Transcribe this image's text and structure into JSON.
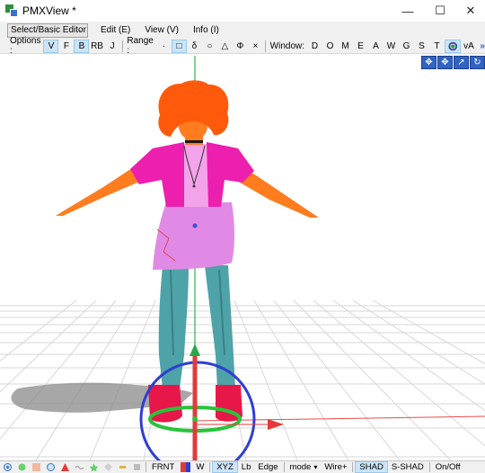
{
  "window": {
    "title": "PMXView *",
    "minimize": "—",
    "maximize": "☐",
    "close": "✕"
  },
  "menubar": {
    "mode_select": "Select/Basic Editor",
    "edit": "Edit (E)",
    "view": "View (V)",
    "info": "Info (I)"
  },
  "toolbar": {
    "options_label": "Options :",
    "options": [
      "V",
      "F",
      "B",
      "RB",
      "J"
    ],
    "range_label": "Range :",
    "range": [
      "·",
      "□",
      "δ",
      "○",
      "△",
      "Φ",
      "×"
    ],
    "window_label": "Window:",
    "window_items": [
      "D",
      "O",
      "M",
      "E",
      "A",
      "W",
      "G",
      "S",
      "T"
    ],
    "va": "vA",
    "more": "»"
  },
  "statusbar": {
    "view_front": "FRNT",
    "w": "W",
    "xyz": "XYZ",
    "local": "Lb",
    "edge": "Edge",
    "mode": "mode",
    "wire": "Wire+",
    "shad": "SHAD",
    "sshad": "S-SHAD",
    "onoff": "On/Off"
  },
  "colors": {
    "accent_active": "#cce4f7",
    "gizmo_blue": "#2f3fd0",
    "gizmo_green": "#27c43a",
    "gizmo_red": "#e23a3a",
    "axis_green": "#2bb54a",
    "axis_red": "#e84a4a"
  }
}
